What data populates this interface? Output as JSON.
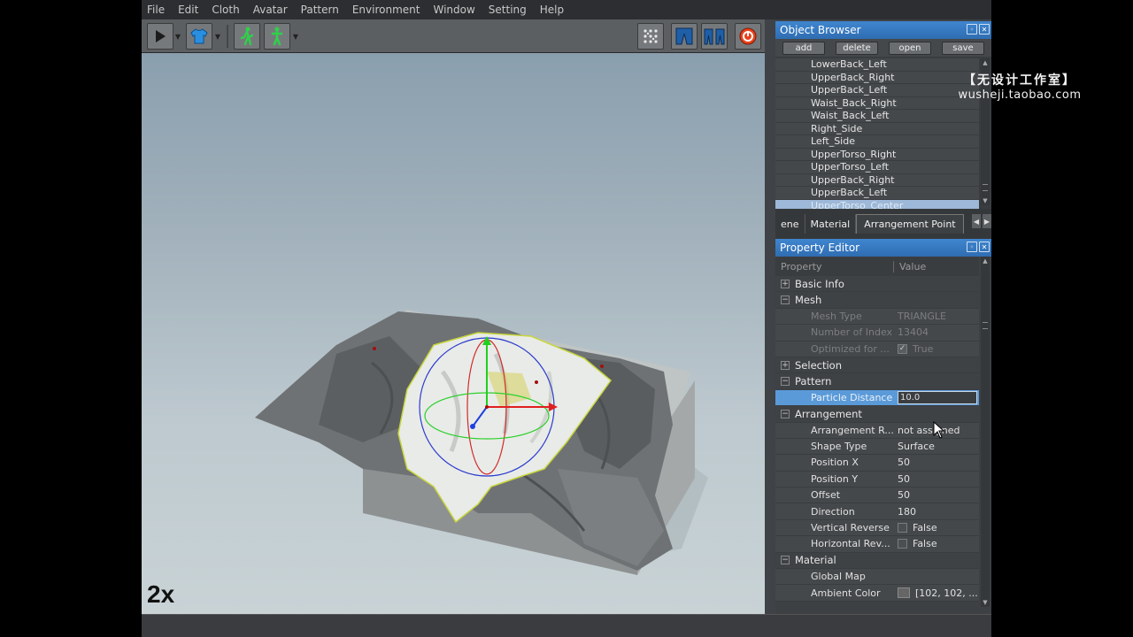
{
  "menu": [
    "File",
    "Edit",
    "Cloth",
    "Avatar",
    "Pattern",
    "Environment",
    "Window",
    "Setting",
    "Help"
  ],
  "viewport": {
    "speed_label": "2x"
  },
  "object_browser": {
    "title": "Object Browser",
    "buttons": [
      "add",
      "delete",
      "open",
      "save"
    ],
    "items": [
      "LowerBack_Left",
      "UpperBack_Right",
      "UpperBack_Left",
      "Waist_Back_Right",
      "Waist_Back_Left",
      "Right_Side",
      "Left_Side",
      "UpperTorso_Right",
      "UpperTorso_Left",
      "UpperBack_Right",
      "UpperBack_Left",
      "UpperTorso_Center"
    ],
    "selected_index": 11
  },
  "tabs": {
    "items": [
      "ene",
      "Material",
      "Arrangement Point"
    ],
    "active_index": 2
  },
  "property_editor": {
    "title": "Property Editor",
    "header_property": "Property",
    "header_value": "Value",
    "groups": {
      "basic_info": "Basic Info",
      "mesh": "Mesh",
      "selection": "Selection",
      "pattern": "Pattern",
      "arrangement": "Arrangement",
      "material": "Material"
    },
    "mesh": {
      "mesh_type_label": "Mesh Type",
      "mesh_type_value": "TRIANGLE",
      "num_index_label": "Number of Index",
      "num_index_value": "13404",
      "optimized_label": "Optimized for ...",
      "optimized_value": "True"
    },
    "pattern": {
      "particle_distance_label": "Particle Distance",
      "particle_distance_value": "10.0"
    },
    "arrangement": {
      "arr_ref_label": "Arrangement R...",
      "arr_ref_value": "not assigned",
      "shape_type_label": "Shape Type",
      "shape_type_value": "Surface",
      "pos_x_label": "Position X",
      "pos_x_value": "50",
      "pos_y_label": "Position Y",
      "pos_y_value": "50",
      "offset_label": "Offset",
      "offset_value": "50",
      "direction_label": "Direction",
      "direction_value": "180",
      "vrev_label": "Vertical Reverse",
      "vrev_value": "False",
      "hrev_label": "Horizontal Rev...",
      "hrev_value": "False"
    },
    "material": {
      "global_map_label": "Global Map",
      "ambient_label": "Ambient Color",
      "ambient_value": "[102, 102, ..."
    }
  },
  "watermark": {
    "line1": "【无设计工作室】",
    "line2": "wusheji.taobao.com"
  },
  "colors": {
    "title_bar": "#3f86d0",
    "selection": "#5b9ad8",
    "viewport_top": "#8a9fae"
  }
}
